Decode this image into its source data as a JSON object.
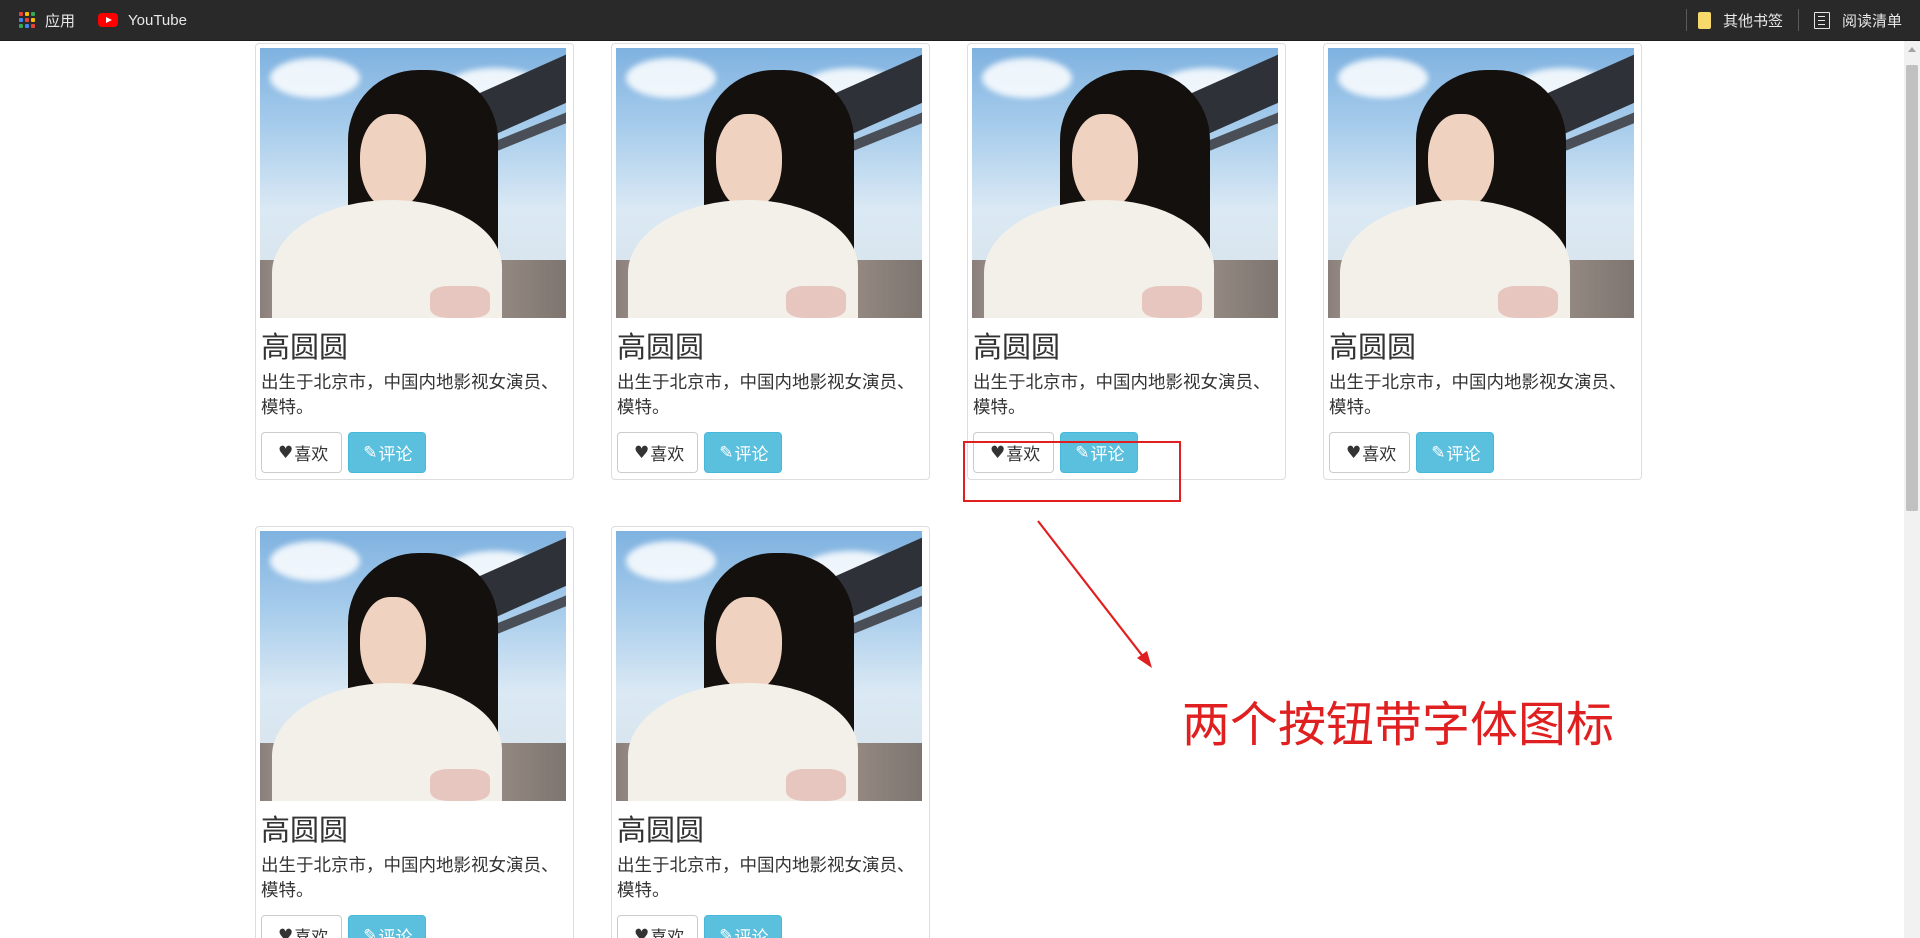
{
  "bookmarks_bar": {
    "apps_label": "应用",
    "youtube_label": "YouTube",
    "other_bookmarks_label": "其他书签",
    "reading_list_label": "阅读清单"
  },
  "cards": [
    {
      "name": "高圆圆",
      "description": "出生于北京市，中国内地影视女演员、模特。",
      "like_label": "喜欢",
      "comment_label": "评论"
    },
    {
      "name": "高圆圆",
      "description": "出生于北京市，中国内地影视女演员、模特。",
      "like_label": "喜欢",
      "comment_label": "评论"
    },
    {
      "name": "高圆圆",
      "description": "出生于北京市，中国内地影视女演员、模特。",
      "like_label": "喜欢",
      "comment_label": "评论"
    },
    {
      "name": "高圆圆",
      "description": "出生于北京市，中国内地影视女演员、模特。",
      "like_label": "喜欢",
      "comment_label": "评论"
    },
    {
      "name": "高圆圆",
      "description": "出生于北京市，中国内地影视女演员、模特。",
      "like_label": "喜欢",
      "comment_label": "评论"
    },
    {
      "name": "高圆圆",
      "description": "出生于北京市，中国内地影视女演员、模特。",
      "like_label": "喜欢",
      "comment_label": "评论"
    }
  ],
  "icons": {
    "like": "heart-icon",
    "comment": "pencil-icon"
  },
  "annotation": {
    "text": "两个按钮带字体图标",
    "color": "#e02020"
  },
  "colors": {
    "info_button": "#5bc0de",
    "bookmarks_bar": "#292929"
  }
}
